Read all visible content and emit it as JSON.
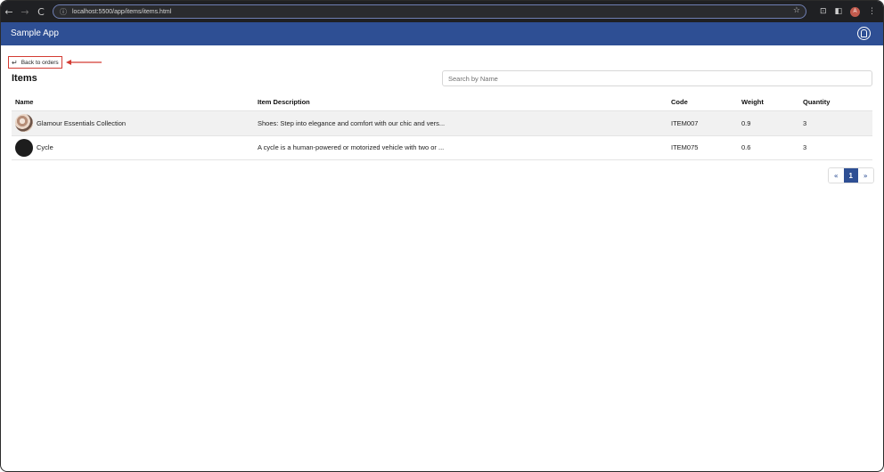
{
  "browser": {
    "url": "localhost:5500/app/items/items.html",
    "back_icon": "←",
    "forward_icon": "→",
    "reload_icon": "C",
    "info_icon": "ⓘ",
    "star_icon": "☆",
    "extensions_icon": "⊡",
    "sidepanel_icon": "◧",
    "profile_initial": "A",
    "menu_icon": "⋮"
  },
  "app": {
    "brand": "Sample App"
  },
  "nav": {
    "back_label": "Back to orders",
    "back_icon": "↵"
  },
  "page": {
    "title": "Items"
  },
  "search": {
    "placeholder": "Search by Name"
  },
  "table": {
    "headers": {
      "name": "Name",
      "description": "Item Description",
      "code": "Code",
      "weight": "Weight",
      "quantity": "Quantity"
    },
    "rows": [
      {
        "name": "Glamour Essentials Collection",
        "description": "Shoes: Step into elegance and comfort with our chic and vers...",
        "code": "ITEM007",
        "weight": "0.9",
        "quantity": "3"
      },
      {
        "name": "Cycle",
        "description": "A cycle is a human-powered or motorized vehicle with two or ...",
        "code": "ITEM075",
        "weight": "0.6",
        "quantity": "3"
      }
    ]
  },
  "pagination": {
    "prev": "«",
    "current": "1",
    "next": "»"
  },
  "colors": {
    "brand": "#2e4f94",
    "annotation": "#d33b33"
  }
}
